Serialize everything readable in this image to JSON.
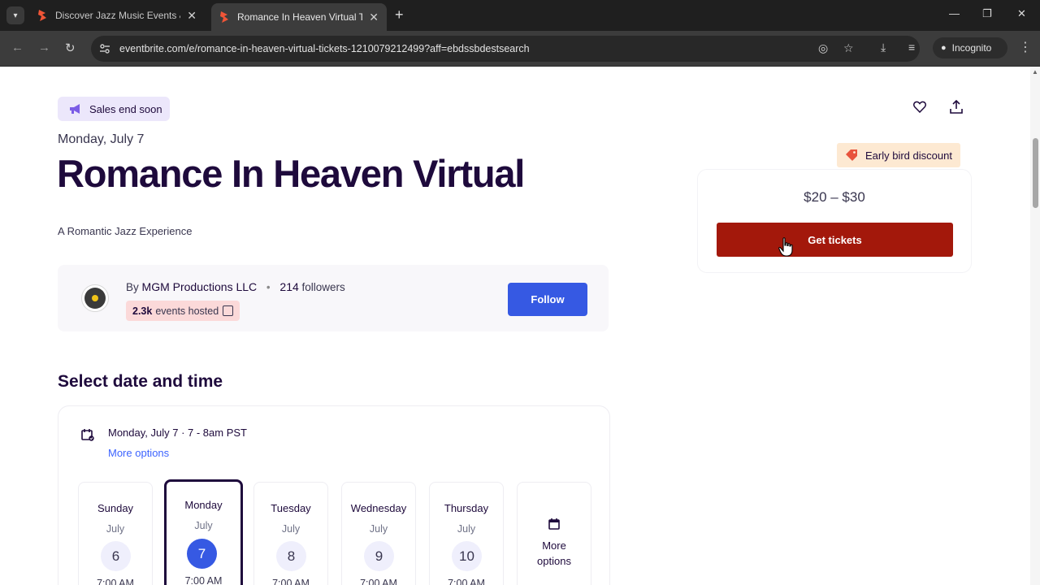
{
  "browser": {
    "tabs": [
      {
        "title": "Discover Jazz Music Events & Activities",
        "close": "✕"
      },
      {
        "title": "Romance In Heaven Virtual Tickets",
        "close": "✕"
      }
    ],
    "new_tab": "+",
    "window_controls": {
      "minimize": "—",
      "restore": "❐",
      "close": "✕"
    },
    "url": "eventbrite.com/e/romance-in-heaven-virtual-tickets-1210079212499?aff=ebdssbdestsearch",
    "incognito_label": "Incognito"
  },
  "event": {
    "badge": "Sales end soon",
    "date": "Monday, July 7",
    "title": "Romance In Heaven Virtual",
    "summary": "A Romantic Jazz Experience"
  },
  "organizer": {
    "by_prefix": "By",
    "name": "MGM Productions LLC",
    "followers_count": "214",
    "followers_label": "followers",
    "events_count": "2.3k",
    "events_label": "events hosted",
    "follow_label": "Follow"
  },
  "date_picker": {
    "section_title": "Select date and time",
    "selected_text": "Monday, July 7 · 7 - 8am PST",
    "more_options_link": "More options",
    "days": [
      {
        "name": "Sunday",
        "month": "July",
        "num": "6",
        "time": "7:00 AM"
      },
      {
        "name": "Monday",
        "month": "July",
        "num": "7",
        "time": "7:00 AM",
        "selected": true
      },
      {
        "name": "Tuesday",
        "month": "July",
        "num": "8",
        "time": "7:00 AM"
      },
      {
        "name": "Wednesday",
        "month": "July",
        "num": "9",
        "time": "7:00 AM"
      },
      {
        "name": "Thursday",
        "month": "July",
        "num": "10",
        "time": "7:00 AM"
      }
    ],
    "more_day_label_1": "More",
    "more_day_label_2": "options"
  },
  "tickets": {
    "discount_badge": "Early bird discount",
    "price": "$20 – $30",
    "cta": "Get tickets"
  },
  "colors": {
    "brand_dark": "#1e0a3c",
    "follow_blue": "#3659e3",
    "cta_red": "#a3180b"
  }
}
